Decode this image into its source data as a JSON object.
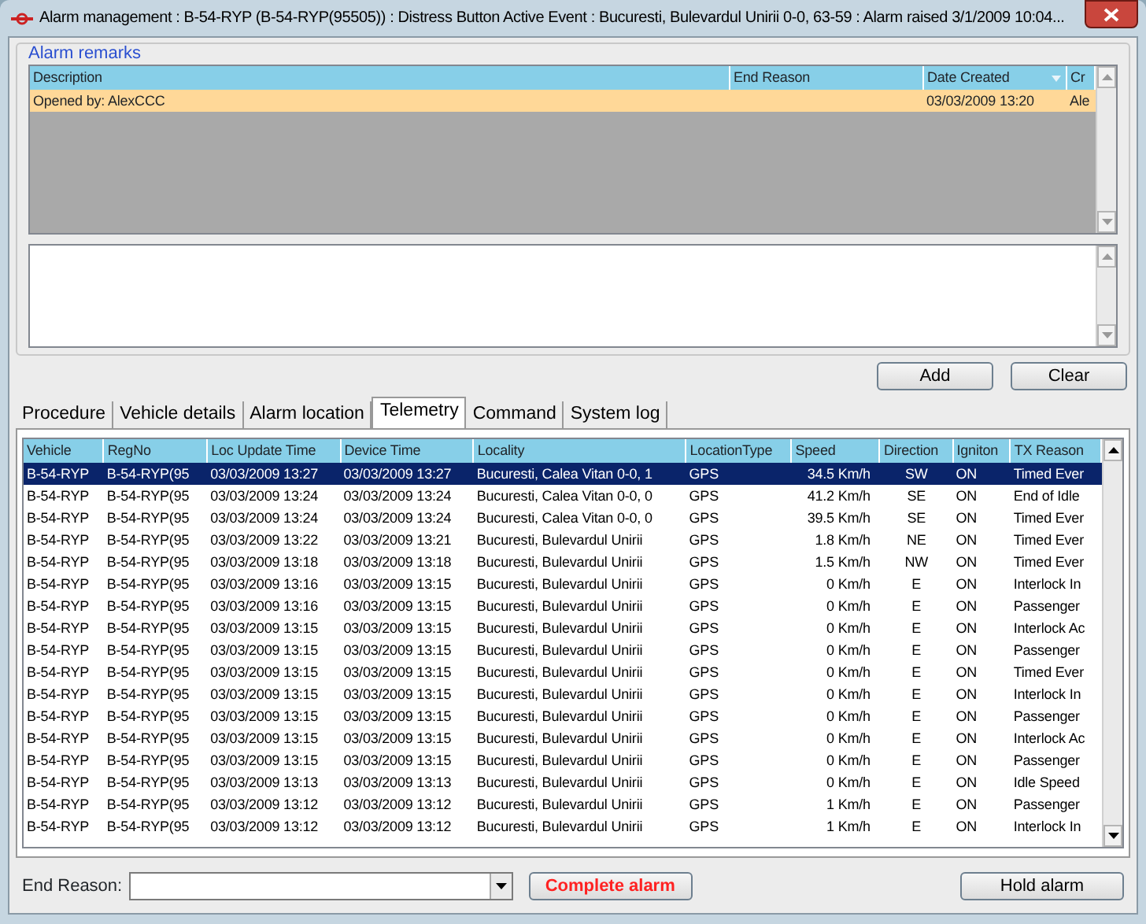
{
  "window": {
    "title": "Alarm management : B-54-RYP (B-54-RYP(95505)) : Distress Button Active Event : Bucuresti, Bulevardul Unirii 0-0, 63-59 : Alarm raised 3/1/2009 10:04..."
  },
  "remarks": {
    "legend": "Alarm remarks",
    "columns": [
      "Description",
      "End Reason",
      "Date Created",
      "Cr"
    ],
    "rows": [
      {
        "cells": [
          "Opened by: AlexCCC",
          "",
          "03/03/2009 13:20",
          "Ale"
        ]
      }
    ],
    "buttons": [
      "Add",
      "Clear"
    ]
  },
  "tabs": [
    {
      "label": "Procedure",
      "selected": false
    },
    {
      "label": "Vehicle details",
      "selected": false
    },
    {
      "label": "Alarm location",
      "selected": false
    },
    {
      "label": "Telemetry",
      "selected": true
    },
    {
      "label": "Command",
      "selected": false
    },
    {
      "label": "System log",
      "selected": false
    }
  ],
  "telemetry": {
    "columns": [
      "Vehicle",
      "RegNo",
      "Loc Update Time",
      "Device Time",
      "Locality",
      "LocationType",
      "Speed",
      "Direction",
      "Igniton",
      "TX Reason"
    ],
    "rows": [
      {
        "selected": true,
        "cells": [
          "B-54-RYP",
          "B-54-RYP(95",
          "03/03/2009 13:27",
          "03/03/2009 13:27",
          "Bucuresti, Calea Vitan 0-0, 1",
          "GPS",
          "34.5 Km/h",
          "SW",
          "ON",
          "Timed Ever"
        ]
      },
      {
        "selected": false,
        "cells": [
          "B-54-RYP",
          "B-54-RYP(95",
          "03/03/2009 13:24",
          "03/03/2009 13:24",
          "Bucuresti, Calea Vitan 0-0, 0",
          "GPS",
          "41.2 Km/h",
          "SE",
          "ON",
          "End of Idle"
        ]
      },
      {
        "selected": false,
        "cells": [
          "B-54-RYP",
          "B-54-RYP(95",
          "03/03/2009 13:24",
          "03/03/2009 13:24",
          "Bucuresti, Calea Vitan 0-0, 0",
          "GPS",
          "39.5 Km/h",
          "SE",
          "ON",
          "Timed Ever"
        ]
      },
      {
        "selected": false,
        "cells": [
          "B-54-RYP",
          "B-54-RYP(95",
          "03/03/2009 13:22",
          "03/03/2009 13:21",
          "Bucuresti, Bulevardul Unirii",
          "GPS",
          "1.8 Km/h",
          "NE",
          "ON",
          "Timed Ever"
        ]
      },
      {
        "selected": false,
        "cells": [
          "B-54-RYP",
          "B-54-RYP(95",
          "03/03/2009 13:18",
          "03/03/2009 13:18",
          "Bucuresti, Bulevardul Unirii",
          "GPS",
          "1.5 Km/h",
          "NW",
          "ON",
          "Timed Ever"
        ]
      },
      {
        "selected": false,
        "cells": [
          "B-54-RYP",
          "B-54-RYP(95",
          "03/03/2009 13:16",
          "03/03/2009 13:15",
          "Bucuresti, Bulevardul Unirii",
          "GPS",
          "0 Km/h",
          "E",
          "ON",
          "Interlock In"
        ]
      },
      {
        "selected": false,
        "cells": [
          "B-54-RYP",
          "B-54-RYP(95",
          "03/03/2009 13:16",
          "03/03/2009 13:15",
          "Bucuresti, Bulevardul Unirii",
          "GPS",
          "0 Km/h",
          "E",
          "ON",
          "Passenger"
        ]
      },
      {
        "selected": false,
        "cells": [
          "B-54-RYP",
          "B-54-RYP(95",
          "03/03/2009 13:15",
          "03/03/2009 13:15",
          "Bucuresti, Bulevardul Unirii",
          "GPS",
          "0 Km/h",
          "E",
          "ON",
          "Interlock Ac"
        ]
      },
      {
        "selected": false,
        "cells": [
          "B-54-RYP",
          "B-54-RYP(95",
          "03/03/2009 13:15",
          "03/03/2009 13:15",
          "Bucuresti, Bulevardul Unirii",
          "GPS",
          "0 Km/h",
          "E",
          "ON",
          "Passenger"
        ]
      },
      {
        "selected": false,
        "cells": [
          "B-54-RYP",
          "B-54-RYP(95",
          "03/03/2009 13:15",
          "03/03/2009 13:15",
          "Bucuresti, Bulevardul Unirii",
          "GPS",
          "0 Km/h",
          "E",
          "ON",
          "Timed Ever"
        ]
      },
      {
        "selected": false,
        "cells": [
          "B-54-RYP",
          "B-54-RYP(95",
          "03/03/2009 13:15",
          "03/03/2009 13:15",
          "Bucuresti, Bulevardul Unirii",
          "GPS",
          "0 Km/h",
          "E",
          "ON",
          "Interlock In"
        ]
      },
      {
        "selected": false,
        "cells": [
          "B-54-RYP",
          "B-54-RYP(95",
          "03/03/2009 13:15",
          "03/03/2009 13:15",
          "Bucuresti, Bulevardul Unirii",
          "GPS",
          "0 Km/h",
          "E",
          "ON",
          "Passenger"
        ]
      },
      {
        "selected": false,
        "cells": [
          "B-54-RYP",
          "B-54-RYP(95",
          "03/03/2009 13:15",
          "03/03/2009 13:15",
          "Bucuresti, Bulevardul Unirii",
          "GPS",
          "0 Km/h",
          "E",
          "ON",
          "Interlock Ac"
        ]
      },
      {
        "selected": false,
        "cells": [
          "B-54-RYP",
          "B-54-RYP(95",
          "03/03/2009 13:15",
          "03/03/2009 13:15",
          "Bucuresti, Bulevardul Unirii",
          "GPS",
          "0 Km/h",
          "E",
          "ON",
          "Passenger"
        ]
      },
      {
        "selected": false,
        "cells": [
          "B-54-RYP",
          "B-54-RYP(95",
          "03/03/2009 13:13",
          "03/03/2009 13:13",
          "Bucuresti, Bulevardul Unirii",
          "GPS",
          "0 Km/h",
          "E",
          "ON",
          "Idle Speed"
        ]
      },
      {
        "selected": false,
        "cells": [
          "B-54-RYP",
          "B-54-RYP(95",
          "03/03/2009 13:12",
          "03/03/2009 13:12",
          "Bucuresti, Bulevardul Unirii",
          "GPS",
          "1 Km/h",
          "E",
          "ON",
          "Passenger"
        ]
      },
      {
        "selected": false,
        "cells": [
          "B-54-RYP",
          "B-54-RYP(95",
          "03/03/2009 13:12",
          "03/03/2009 13:12",
          "Bucuresti, Bulevardul Unirii",
          "GPS",
          "1 Km/h",
          "E",
          "ON",
          "Interlock In"
        ]
      }
    ]
  },
  "footer": {
    "end_reason_label": "End Reason:",
    "complete_button": "Complete alarm",
    "hold_button": "Hold alarm"
  }
}
